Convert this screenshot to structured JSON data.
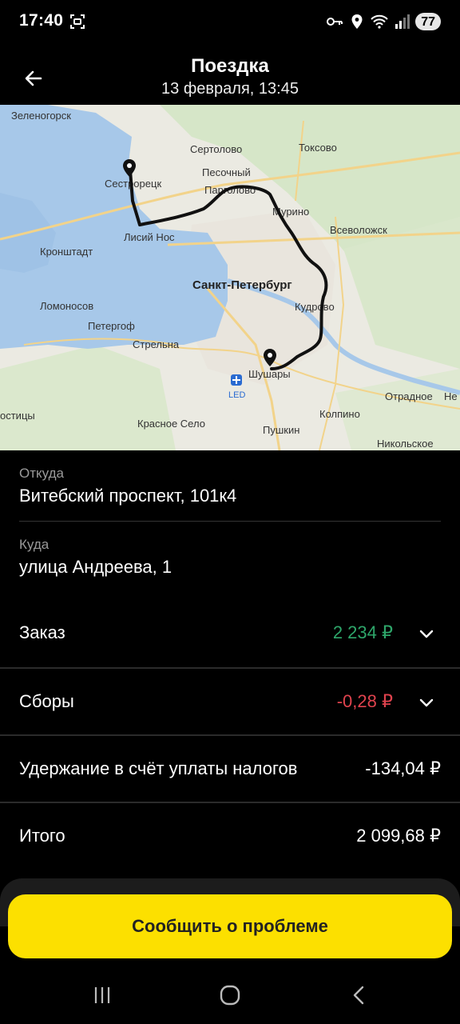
{
  "status_bar": {
    "time": "17:40",
    "battery": "77",
    "icons": [
      "screen-record-icon",
      "vpn-key-icon",
      "location-icon",
      "wifi-icon",
      "signal-icon",
      "battery-icon"
    ]
  },
  "header": {
    "title": "Поездка",
    "subtitle": "13 февраля, 13:45"
  },
  "map": {
    "labels": {
      "zelenogorsk": "Зеленогорск",
      "sertolovo": "Сертолово",
      "toksovo": "Токсово",
      "sestroretsk": "Сестрорецк",
      "pesochny": "Песочный",
      "pargolovo": "Парголово",
      "murino": "Мурино",
      "vsevolozhsk": "Всеволожск",
      "lisiy_nos": "Лисий Нос",
      "kronshtadt": "Кронштадт",
      "spb": "Санкт-Петербург",
      "lomonosov": "Ломоносов",
      "kudrovo": "Кудрово",
      "petergof": "Петергоф",
      "strelna": "Стрельна",
      "shushary": "Шушары",
      "led": "LED",
      "otradnoe": "Отрадное",
      "nevsky": "Не",
      "ostitsy": "остицы",
      "kolpino": "Колпино",
      "krasnoe_selo": "Красное Село",
      "pushkin": "Пушкин",
      "nikolskoe": "Никольское"
    }
  },
  "trip": {
    "from_label": "Откуда",
    "from_value": "Витебский проспект, 101к4",
    "to_label": "Куда",
    "to_value": "улица Андреева, 1"
  },
  "finance": {
    "order_label": "Заказ",
    "order_value": "2 234 ₽",
    "fees_label": "Сборы",
    "fees_value": "-0,28 ₽",
    "tax_label": "Удержание в счёт уплаты налогов",
    "tax_value": "-134,04 ₽",
    "total_label": "Итого",
    "total_value": "2 099,68 ₽",
    "colors": {
      "positive": "#2ea66a",
      "negative": "#e0434e"
    }
  },
  "actions": {
    "report_button": "Сообщить о проблеме"
  },
  "navbar": {
    "icons": [
      "recent-apps-icon",
      "home-icon",
      "back-nav-icon"
    ]
  }
}
